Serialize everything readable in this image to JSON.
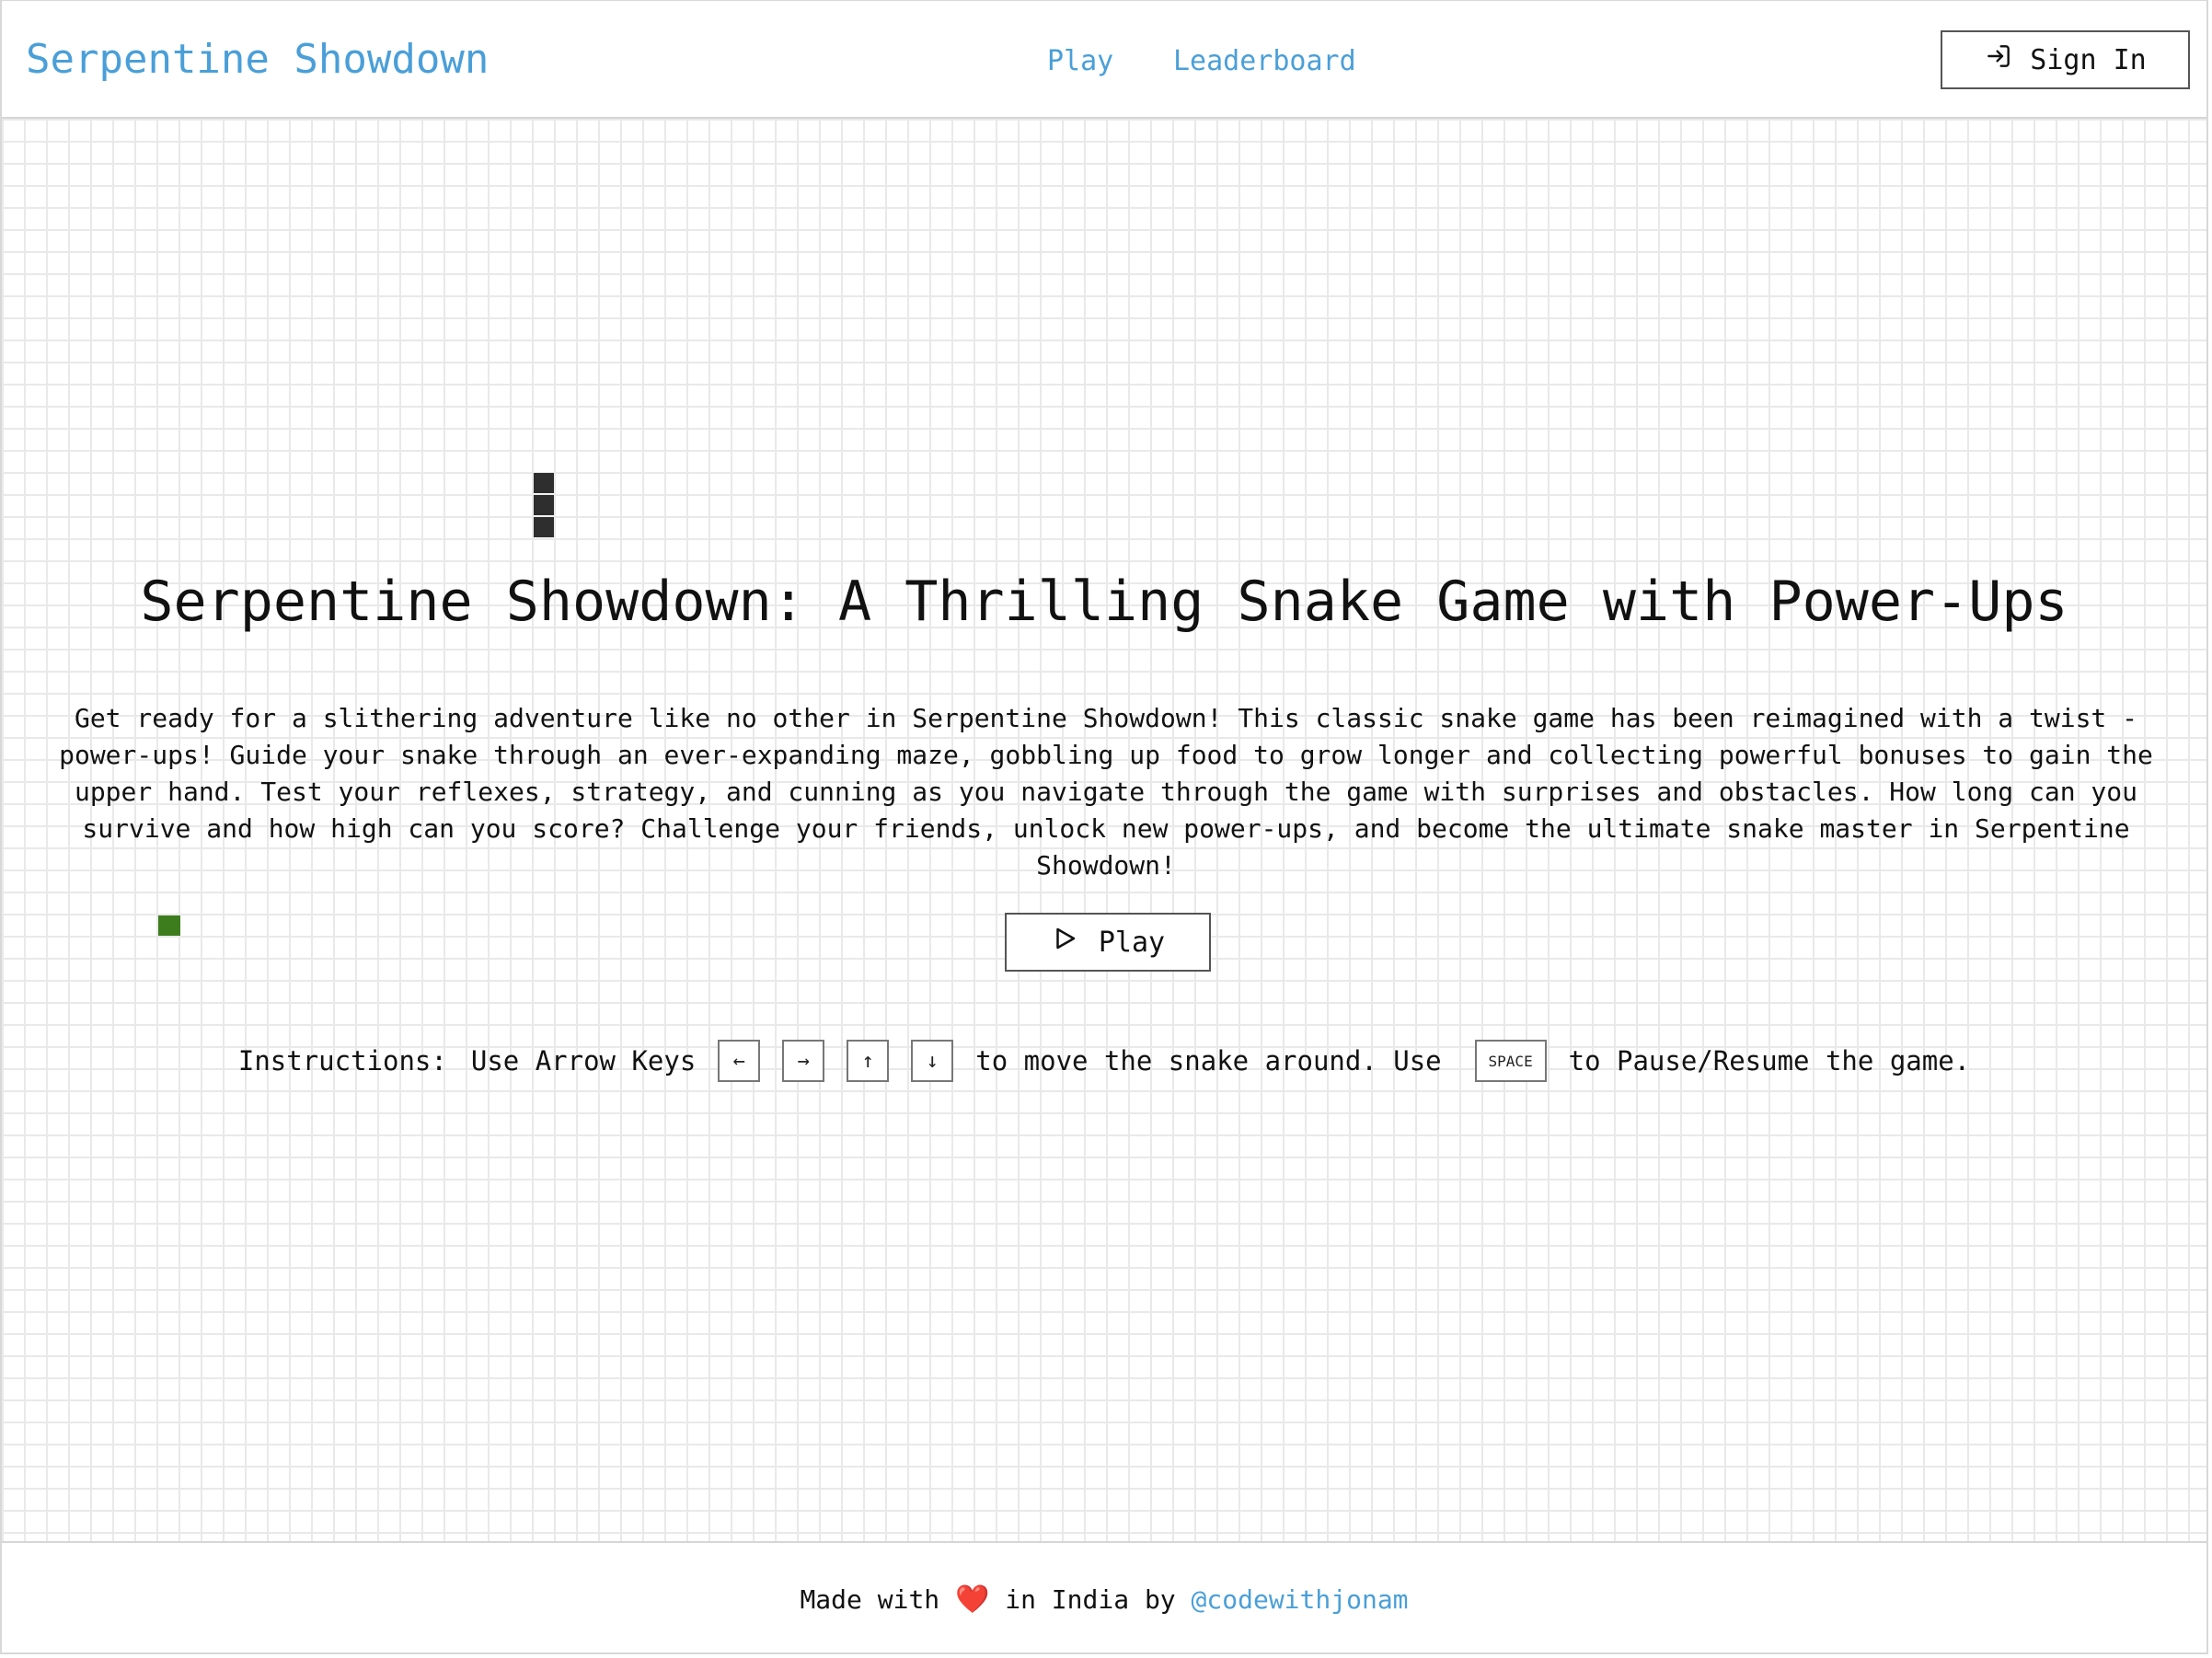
{
  "header": {
    "brand": "Serpentine Showdown",
    "nav": [
      {
        "label": "Play"
      },
      {
        "label": "Leaderboard"
      }
    ],
    "signin_label": "Sign In",
    "signin_icon": "sign-in-icon"
  },
  "hero": {
    "title": "Serpentine Showdown: A Thrilling Snake Game with Power-Ups",
    "description": "Get ready for a slithering adventure like no other in Serpentine Showdown! This classic snake game has been reimagined with a twist - power-ups! Guide your snake through an ever-expanding maze, gobbling up food to grow longer and collecting powerful bonuses to gain the upper hand. Test your reflexes, strategy, and cunning as you navigate through the game with surprises and obstacles. How long can you survive and how high can you score? Challenge your friends, unlock new power-ups, and become the ultimate snake master in Serpentine Showdown!",
    "play_label": "Play",
    "play_icon": "play-icon"
  },
  "instructions": {
    "label": "Instructions:",
    "arrow_text": "Use Arrow Keys",
    "keys": [
      "←",
      "→",
      "↑",
      "↓"
    ],
    "move_text": "to move the snake around. Use",
    "space_key": "SPACE",
    "pause_text": "to Pause/Resume the game."
  },
  "game": {
    "snake_color": "#2e2e2e",
    "food_color": "#3d7d1e"
  },
  "footer": {
    "made_with": "Made with",
    "heart": "❤️",
    "in_india_by": "in India by",
    "author_link": "@codewithjonam"
  },
  "colors": {
    "accent": "#4a9fd8"
  }
}
